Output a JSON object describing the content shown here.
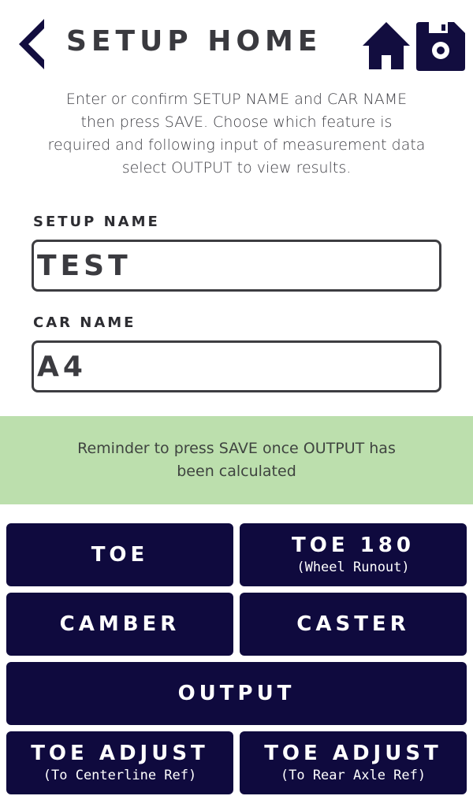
{
  "header": {
    "title": "SETUP HOME",
    "back_icon": "chevron-left-icon",
    "home_icon": "home-icon",
    "save_icon": "floppy-disk-icon",
    "icon_color": "#120d3f"
  },
  "instructions": "Enter or confirm SETUP NAME and CAR NAME then press SAVE. Choose which feature is required and following input of measurement data select OUTPUT to view results.",
  "form": {
    "setup_name_label": "SETUP NAME",
    "setup_name_value": "TEST",
    "car_name_label": "CAR NAME",
    "car_name_value": "A4"
  },
  "reminder": {
    "text": "Reminder to press SAVE once OUTPUT has been calculated",
    "background": "#bcdfad"
  },
  "buttons": {
    "toe": {
      "label": "TOE"
    },
    "toe180": {
      "label": "TOE 180",
      "sub": "(Wheel Runout)"
    },
    "camber": {
      "label": "CAMBER"
    },
    "caster": {
      "label": "CASTER"
    },
    "output": {
      "label": "OUTPUT"
    },
    "toe_adjust_centerline": {
      "label": "TOE ADJUST",
      "sub": "(To Centerline Ref)"
    },
    "toe_adjust_rear": {
      "label": "TOE ADJUST",
      "sub": "(To Rear Axle Ref)"
    },
    "color": "#0f0a3e"
  }
}
